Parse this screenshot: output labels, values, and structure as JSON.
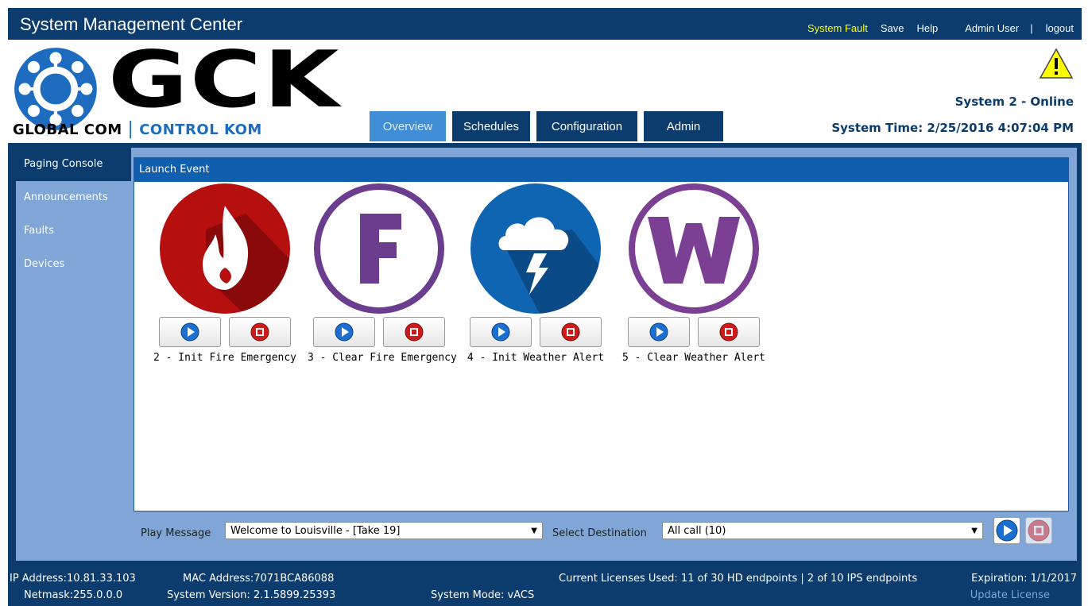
{
  "app": {
    "title": "System Management Center"
  },
  "topnav": {
    "fault": "System Fault",
    "save": "Save",
    "help": "Help",
    "user": "Admin User",
    "separator": "|",
    "logout": "logout"
  },
  "logo": {
    "main": "GCK",
    "sub_left": "GLOBAL COM",
    "sub_sep": "|",
    "sub_right": "CONTROL KOM"
  },
  "tabs": [
    "Overview",
    "Schedules",
    "Configuration",
    "Admin"
  ],
  "status": {
    "system": "System 2 - Online",
    "time": "System Time: 2/25/2016 4:07:04 PM"
  },
  "sidebar": {
    "items": [
      "Paging Console",
      "Announcements",
      "Faults",
      "Devices"
    ]
  },
  "panel": {
    "title": "Launch Event"
  },
  "events": [
    {
      "label": "2 - Init Fire Emergency",
      "icon": "fire-icon",
      "color": "#b50f10"
    },
    {
      "label": "3 - Clear Fire Emergency",
      "icon": "letter-f-icon",
      "color": "#6b3d8f"
    },
    {
      "label": "4 - Init Weather Alert",
      "icon": "storm-cloud-icon",
      "color": "#0f65b2"
    },
    {
      "label": "5 - Clear Weather Alert",
      "icon": "letter-w-icon",
      "color": "#7b3f93"
    }
  ],
  "bottom": {
    "play_label": "Play Message",
    "play_value": "Welcome to Louisville - [Take 19]",
    "dest_label": "Select Destination",
    "dest_value": "All call (10)"
  },
  "footer": {
    "ip": "IP Address:10.81.33.103",
    "netmask": "Netmask:255.0.0.0",
    "mac": "MAC Address:7071BCA86088",
    "version": "System Version: 2.1.5899.25393",
    "mode": "System Mode:  vACS",
    "licenses": "Current Licenses Used: 11 of 30 HD endpoints | 2 of 10 IPS endpoints",
    "expiration": "Expiration: 1/1/2017",
    "update": "Update License"
  }
}
